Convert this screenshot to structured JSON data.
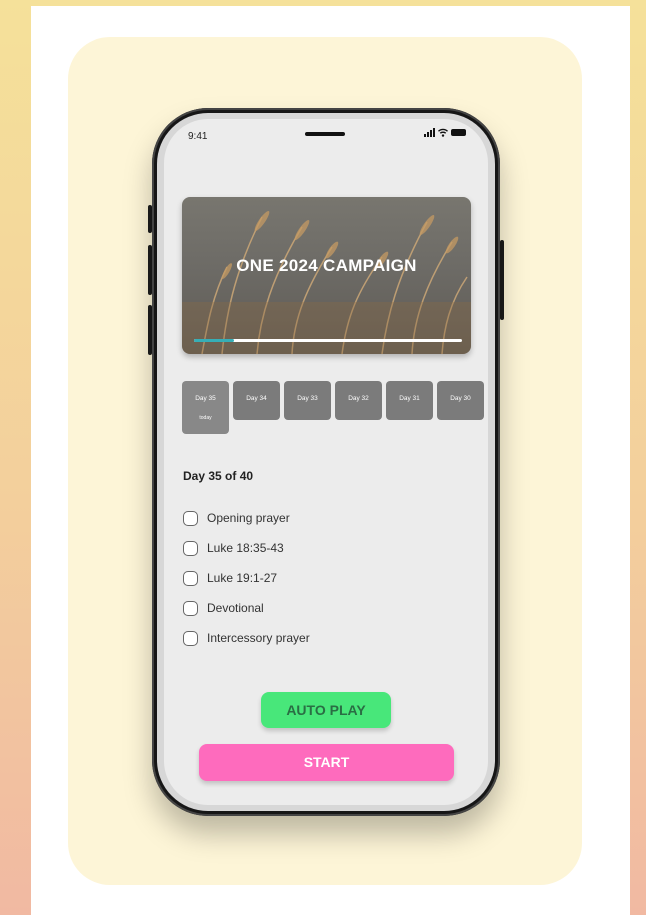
{
  "status_bar": {
    "time": "9:41"
  },
  "hero": {
    "title": "ONE 2024 CAMPAIGN",
    "progress": 0.15
  },
  "days": [
    {
      "label": "Day 35",
      "sub": "today"
    },
    {
      "label": "Day 34"
    },
    {
      "label": "Day 33"
    },
    {
      "label": "Day 32"
    },
    {
      "label": "Day 31"
    },
    {
      "label": "Day 30"
    }
  ],
  "day_heading": "Day 35 of 40",
  "tasks": [
    {
      "label": "Opening prayer",
      "checked": false
    },
    {
      "label": "Luke 18:35-43",
      "checked": false
    },
    {
      "label": "Luke 19:1-27",
      "checked": false
    },
    {
      "label": "Devotional",
      "checked": false
    },
    {
      "label": "Intercessory prayer",
      "checked": false
    }
  ],
  "buttons": {
    "auto_play": "AUTO PLAY",
    "start": "START"
  },
  "colors": {
    "progress": "#36aeb6",
    "auto_play": "#48e77a",
    "start": "#fe6bbd",
    "panel": "#fdf5d7"
  }
}
